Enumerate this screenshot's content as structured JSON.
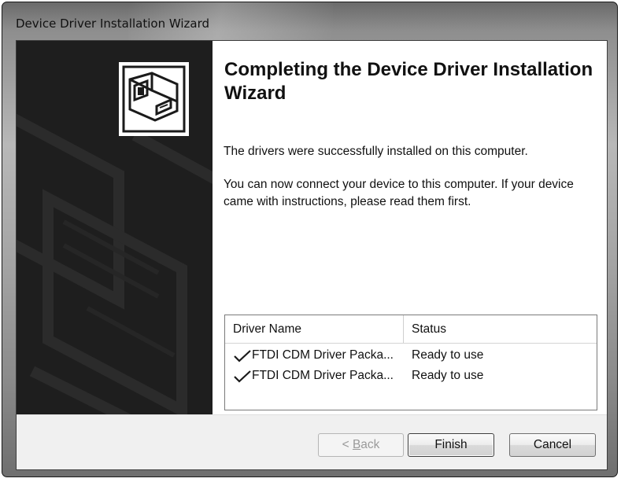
{
  "window": {
    "title": "Device Driver Installation Wizard"
  },
  "wizard": {
    "heading": "Completing the Device Driver Installation Wizard",
    "success_message": "The drivers were successfully installed on this computer.",
    "instructions": "You can now connect your device to this computer. If your device came with instructions, please read them first."
  },
  "driver_list": {
    "columns": {
      "name": "Driver Name",
      "status": "Status"
    },
    "rows": [
      {
        "name": "FTDI CDM Driver Packa...",
        "status": "Ready to use",
        "icon": "checkmark-icon"
      },
      {
        "name": "FTDI CDM Driver Packa...",
        "status": "Ready to use",
        "icon": "checkmark-icon"
      }
    ]
  },
  "buttons": {
    "back_prefix": "< ",
    "back_mnemonic": "B",
    "back_rest": "ack",
    "back_enabled": false,
    "finish": "Finish",
    "cancel": "Cancel"
  },
  "icons": {
    "wizard_logo": "driver-install-icon"
  }
}
